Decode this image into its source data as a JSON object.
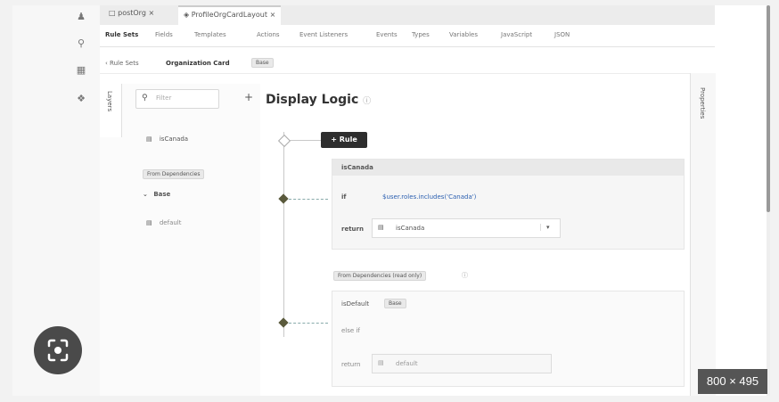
{
  "tabs": [
    {
      "label": "postOrg",
      "active": false
    },
    {
      "label": "ProfileOrgCardLayout",
      "active": true
    }
  ],
  "subtabs": [
    "Rule Sets",
    "Fields",
    "Templates",
    "Actions",
    "Event Listeners",
    "Events",
    "Types",
    "Variables",
    "JavaScript",
    "JSON"
  ],
  "breadcrumb": {
    "back": "Rule Sets",
    "name": "Organization Card",
    "badge": "Base"
  },
  "layers": {
    "tab_label": "Layers",
    "filter_placeholder": "Filter",
    "add": "+",
    "item1": "isCanada",
    "section_chip": "From Dependencies",
    "group": "Base",
    "item2": "default"
  },
  "canvas": {
    "title": "Display Logic",
    "add_rule": "Rule",
    "rule1": {
      "name": "isCanada",
      "if_label": "if",
      "expression": "$user.roles.includes('Canada')",
      "return_label": "return",
      "return_value": "isCanada"
    },
    "dependencies_chip": "From Dependencies (read only)",
    "rule2": {
      "name": "isDefault",
      "badge": "Base",
      "else_label": "else if",
      "return_label": "return",
      "return_value": "default"
    }
  },
  "properties_label": "Properties",
  "size_badge": "800 × 495",
  "colors": {
    "dark_button": "#2e2e2e",
    "expression_blue": "#2b5fb0",
    "node": "#5a5a3c"
  }
}
